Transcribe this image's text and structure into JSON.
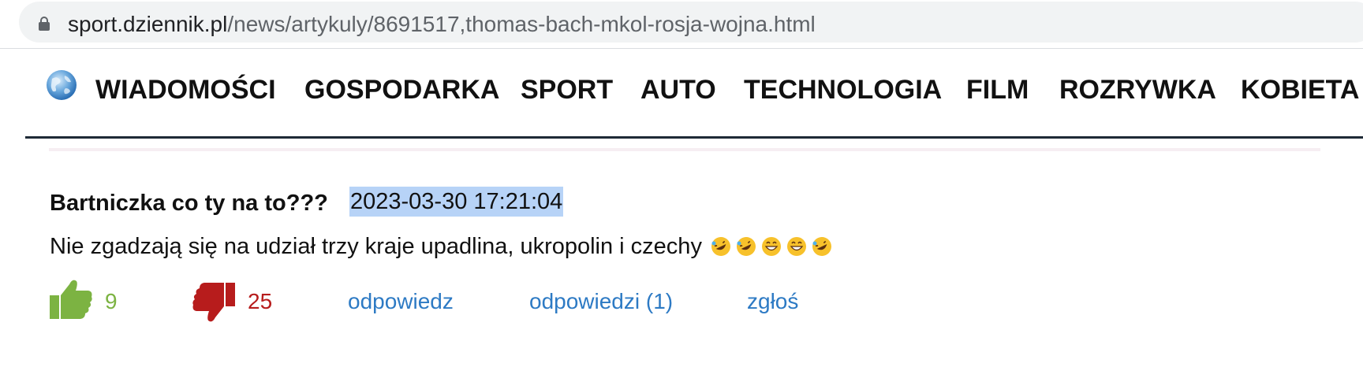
{
  "browser": {
    "url_domain": "sport.dziennik.pl",
    "url_path": "/news/artykuly/8691517,thomas-bach-mkol-rosja-wojna.html"
  },
  "nav": {
    "items": [
      {
        "label": "WIADOMOŚCI"
      },
      {
        "label": "GOSPODARKA"
      },
      {
        "label": "SPORT"
      },
      {
        "label": "AUTO"
      },
      {
        "label": "TECHNOLOGIA"
      },
      {
        "label": "FILM"
      },
      {
        "label": "ROZRYWKA"
      },
      {
        "label": "KOBIETA"
      }
    ]
  },
  "comment": {
    "author": "Bartniczka co ty na to???",
    "date": "2023-03-30 17:21:04",
    "text": "Nie zgadzają się na udział trzy kraje upadlina, ukropolin i czechy",
    "emojis": [
      "rofl-icon",
      "rofl-icon",
      "grin-icon",
      "grin-icon",
      "rofl-icon"
    ],
    "likes": "9",
    "dislikes": "25",
    "reply_label": "odpowiedz",
    "replies_label": "odpowiedzi (1)",
    "report_label": "zgłoś"
  },
  "colors": {
    "like": "#7cb342",
    "dislike": "#b71c1c",
    "link": "#2d7ac4",
    "selection": "#b7d3f7"
  }
}
